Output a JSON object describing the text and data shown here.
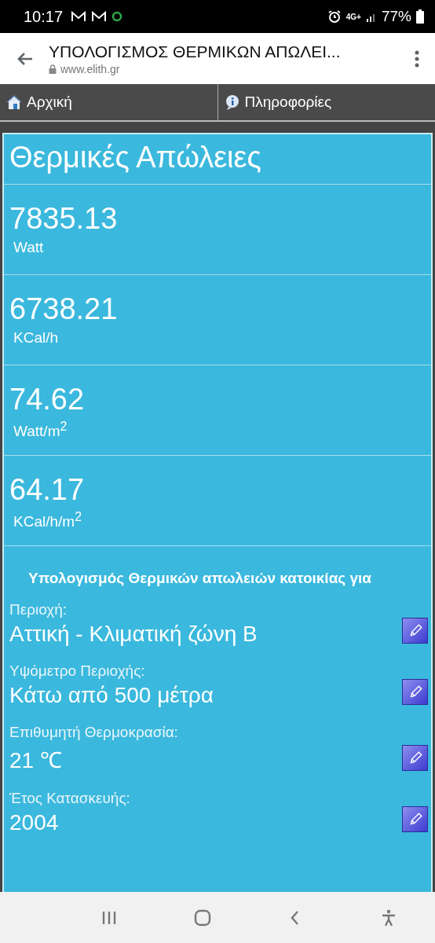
{
  "status_bar": {
    "time": "10:17",
    "network": "4G+",
    "battery": "77%"
  },
  "browser": {
    "title": "ΥΠΟΛΟΓΙΣΜΟΣ ΘΕΡΜΙΚΩΝ ΑΠΩΛΕΙ...",
    "url": "www.elith.gr"
  },
  "nav_tabs": [
    {
      "label": "Αρχική",
      "kind": "home"
    },
    {
      "label": "Πληροφορίες",
      "kind": "info"
    }
  ],
  "card": {
    "title": "Θερμικές Απώλειες",
    "results": [
      {
        "value": "7835.13",
        "unit": "Watt"
      },
      {
        "value": "6738.21",
        "unit": "KCal/h"
      },
      {
        "value": "74.62",
        "unit": "Watt/m$^{2}$"
      },
      {
        "value": "64.17",
        "unit": "KCal/h/m$^{2}$"
      }
    ],
    "details_heading": "Υπολογισμός Θερμικών απωλειών κατοικίας για",
    "fields": [
      {
        "label": "Περιοχή:",
        "value": "Αττική - Κλιματική ζώνη Β"
      },
      {
        "label": "Υψόμετρο Περιοχής:",
        "value": "Κάτω από 500 μέτρα"
      },
      {
        "label": "Επιθυμητή Θερμοκρασία:",
        "value": "21 ℃"
      },
      {
        "label": "Έτος Κατασκευής:",
        "value": "2004"
      }
    ]
  }
}
